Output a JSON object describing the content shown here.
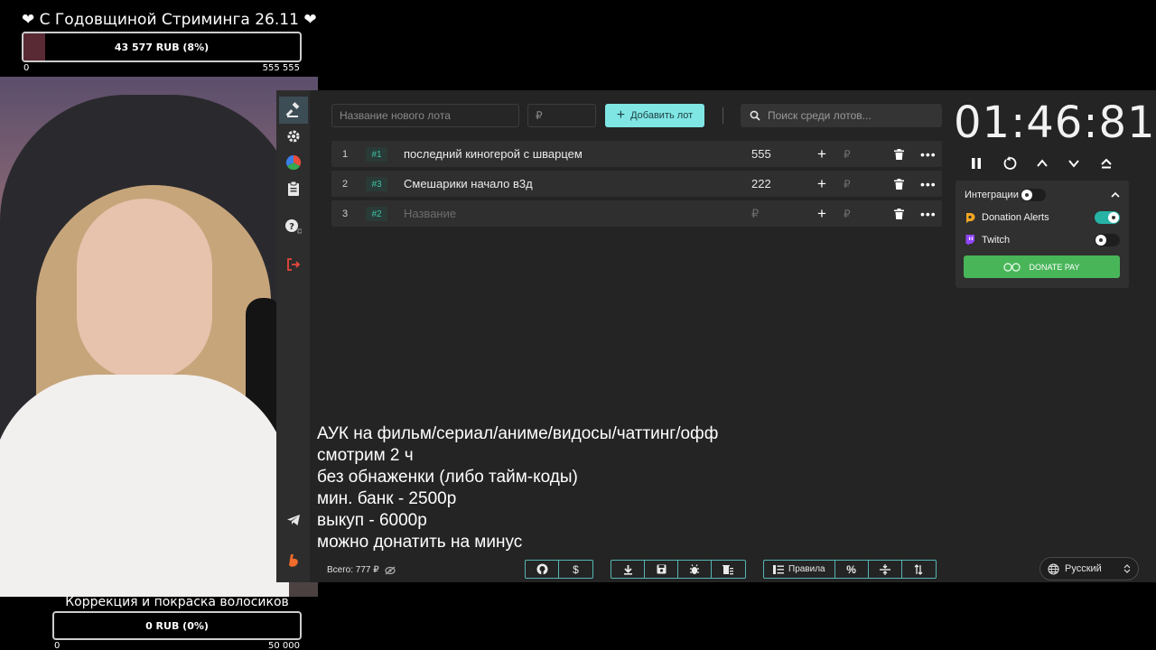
{
  "overlay": {
    "goal_top": {
      "title": "❤ С Годовщиной Стриминга 26.11 ❤",
      "amount_text": "43 577 RUB (8%)",
      "progress": 0.08,
      "min": "0",
      "max": "555 555"
    },
    "goal_bottom": {
      "title": "Коррекция и покраска волосиков",
      "amount_text": "0 RUB (0%)",
      "progress": 0,
      "min": "0",
      "max": "50 000"
    }
  },
  "toolbar": {
    "new_lot_placeholder": "Название нового лота",
    "amount_placeholder": "₽",
    "add_lot_label": "Добавить лот",
    "search_placeholder": "Поиск среди лотов..."
  },
  "lots": [
    {
      "index": "1",
      "id": "#1",
      "name": "последний киногерой с шварцем",
      "amount": "555",
      "rub": "₽"
    },
    {
      "index": "2",
      "id": "#3",
      "name": "Смешарики начало в3д",
      "amount": "222",
      "rub": "₽"
    },
    {
      "index": "3",
      "id": "#2",
      "name": "Название",
      "amount": "₽",
      "rub": "₽"
    }
  ],
  "timer": {
    "value": "01:46:81"
  },
  "integrations": {
    "title": "Интеграции",
    "items": [
      {
        "name": "Donation Alerts",
        "enabled": true
      },
      {
        "name": "Twitch",
        "enabled": false
      }
    ],
    "donatepay_label": "DONATE PAY"
  },
  "notes": [
    "АУК на фильм/сериал/аниме/видосы/чаттинг/офф",
    "смотрим 2 ч",
    "без обнаженки (либо тайм-коды)",
    "мин. банк - 2500р",
    "выкуп - 6000р",
    "можно донатить на минус"
  ],
  "footer": {
    "total": "Всего: 777 ₽",
    "rules_label": "Правила",
    "language": "Русский"
  },
  "colors": {
    "accent": "#7fe6e4",
    "toggle_on": "#26b3a6",
    "donatepay": "#49b559",
    "lot_id": "#3cc3a3"
  }
}
